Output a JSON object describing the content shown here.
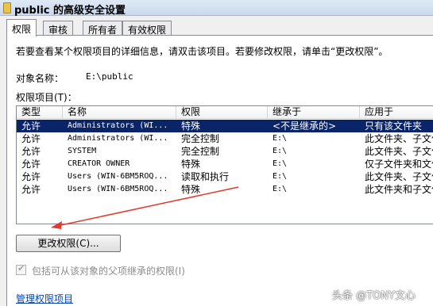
{
  "window": {
    "title": "public 的高级安全设置"
  },
  "tabs": [
    {
      "label": "权限",
      "active": true
    },
    {
      "label": "审核"
    },
    {
      "label": "所有者"
    },
    {
      "label": "有效权限"
    }
  ],
  "intro_text": "若要查看某个权限项目的详细信息，请双击该项目。若要修改权限，请单击“更改权限”。",
  "object": {
    "label": "对象名称：",
    "value": "E:\\public"
  },
  "permissions_label": "权限项目(T)：",
  "columns": [
    "类型",
    "名称",
    "权限",
    "继承于",
    "应用于"
  ],
  "rows": [
    {
      "type": "允许",
      "name": "Administrators (WI...",
      "perm": "特殊",
      "inherit": "<不是继承的>",
      "apply": "只有该文件夹"
    },
    {
      "type": "允许",
      "name": "Administrators (WI...",
      "perm": "完全控制",
      "inherit": "E:\\",
      "apply": "此文件夹、子文件"
    },
    {
      "type": "允许",
      "name": "SYSTEM",
      "perm": "完全控制",
      "inherit": "E:\\",
      "apply": "此文件夹、子文件"
    },
    {
      "type": "允许",
      "name": "CREATOR OWNER",
      "perm": "特殊",
      "inherit": "E:\\",
      "apply": "仅子文件夹和文件"
    },
    {
      "type": "允许",
      "name": "Users (WIN-6BM5ROQ...",
      "perm": "读取和执行",
      "inherit": "E:\\",
      "apply": "此文件夹、子文件"
    },
    {
      "type": "允许",
      "name": "Users (WIN-6BM5ROQ...",
      "perm": "特殊",
      "inherit": "E:\\",
      "apply": "此文件夹和子文件"
    }
  ],
  "change_button": "更改权限(C)...",
  "inherit_checkbox": {
    "label": "包括可从该对象的父项继承的权限(I)",
    "checked": true,
    "disabled": true
  },
  "manage_link": "管理权限项目",
  "watermark": "头条 @TONY文心",
  "colors": {
    "selected_row": "#0a246a",
    "arrow": "#e03a2e",
    "link": "#0645ad"
  },
  "icons": {
    "title": "folder-icon",
    "arrow": "red-arrow-annotation"
  }
}
